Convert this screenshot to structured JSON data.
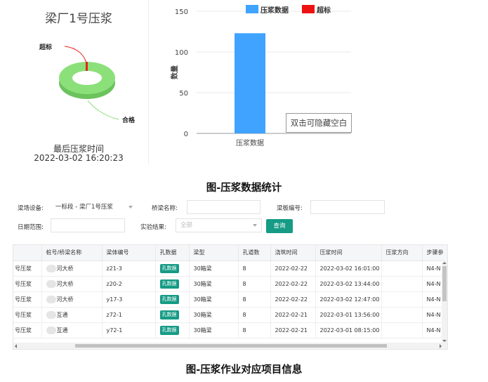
{
  "pie_panel": {
    "title": "梁厂1号压浆",
    "label_over": "超标",
    "label_ok": "合格",
    "last_label": "最后压浆时间",
    "last_time": "2022-03-02 16:20:23",
    "colors": {
      "ok": "#8be07a",
      "over": "#e8211b"
    }
  },
  "chart_data": {
    "type": "bar",
    "categories": [
      "压浆数据"
    ],
    "series": [
      {
        "name": "压浆数据",
        "values": [
          123
        ],
        "color": "#3fa3ff"
      },
      {
        "name": "超标",
        "values": [
          0
        ],
        "color": "#ee1111"
      }
    ],
    "yticks": [
      "150",
      "100",
      "50",
      "0"
    ],
    "ylim": [
      0,
      150
    ],
    "ylabel": "数量",
    "xlabel": "",
    "grid": true,
    "legend": "top"
  },
  "tooltip": "双击可隐藏空白",
  "captions": {
    "stats": "图-压浆数据统计",
    "project": "图-压浆作业对应项目信息"
  },
  "form": {
    "device_label": "梁场设备:",
    "device_value": "一标段 - 梁厂1号压浆",
    "bridge_name_label": "桥梁名称:",
    "bridge_name_value": "",
    "beam_no_label": "梁板编号:",
    "beam_no_value": "",
    "date_label": "日期范围:",
    "date_value": "",
    "result_label": "实验结果:",
    "result_placeholder": "全部",
    "query_button": "查询"
  },
  "table": {
    "headers": [
      "",
      "桩号/桥梁名称",
      "梁体编号",
      "孔数据",
      "梁型",
      "孔道数",
      "浇筑时间",
      "压浆时间",
      "压浆方向",
      "步骤参"
    ],
    "rows": [
      {
        "c0": "号压浆",
        "c1": "河大桥",
        "c2": "z21-3",
        "c3": "孔数据",
        "c4": "30箱梁",
        "c5": "8",
        "c6": "2022-02-22",
        "c7": "2022-03-02 16:01:00",
        "c8": "",
        "c9": "N4-N"
      },
      {
        "c0": "号压浆",
        "c1": "河大桥",
        "c2": "z20-2",
        "c3": "孔数据",
        "c4": "30箱梁",
        "c5": "8",
        "c6": "2022-02-22",
        "c7": "2022-03-02 13:44:00",
        "c8": "",
        "c9": "N4-N"
      },
      {
        "c0": "号压浆",
        "c1": "河大桥",
        "c2": "y17-3",
        "c3": "孔数据",
        "c4": "30箱梁",
        "c5": "8",
        "c6": "2022-02-22",
        "c7": "2022-03-02 12:47:00",
        "c8": "",
        "c9": "N4-N"
      },
      {
        "c0": "号压浆",
        "c1": "互通",
        "c2": "z72-1",
        "c3": "孔数据",
        "c4": "30箱梁",
        "c5": "8",
        "c6": "2022-02-21",
        "c7": "2022-03-01 13:56:00",
        "c8": "",
        "c9": "N4-N"
      },
      {
        "c0": "号压浆",
        "c1": "互通",
        "c2": "y72-1",
        "c3": "孔数据",
        "c4": "30箱梁",
        "c5": "8",
        "c6": "2022-02-21",
        "c7": "2022-03-01 08:15:00",
        "c8": "",
        "c9": "N4-N"
      }
    ]
  }
}
